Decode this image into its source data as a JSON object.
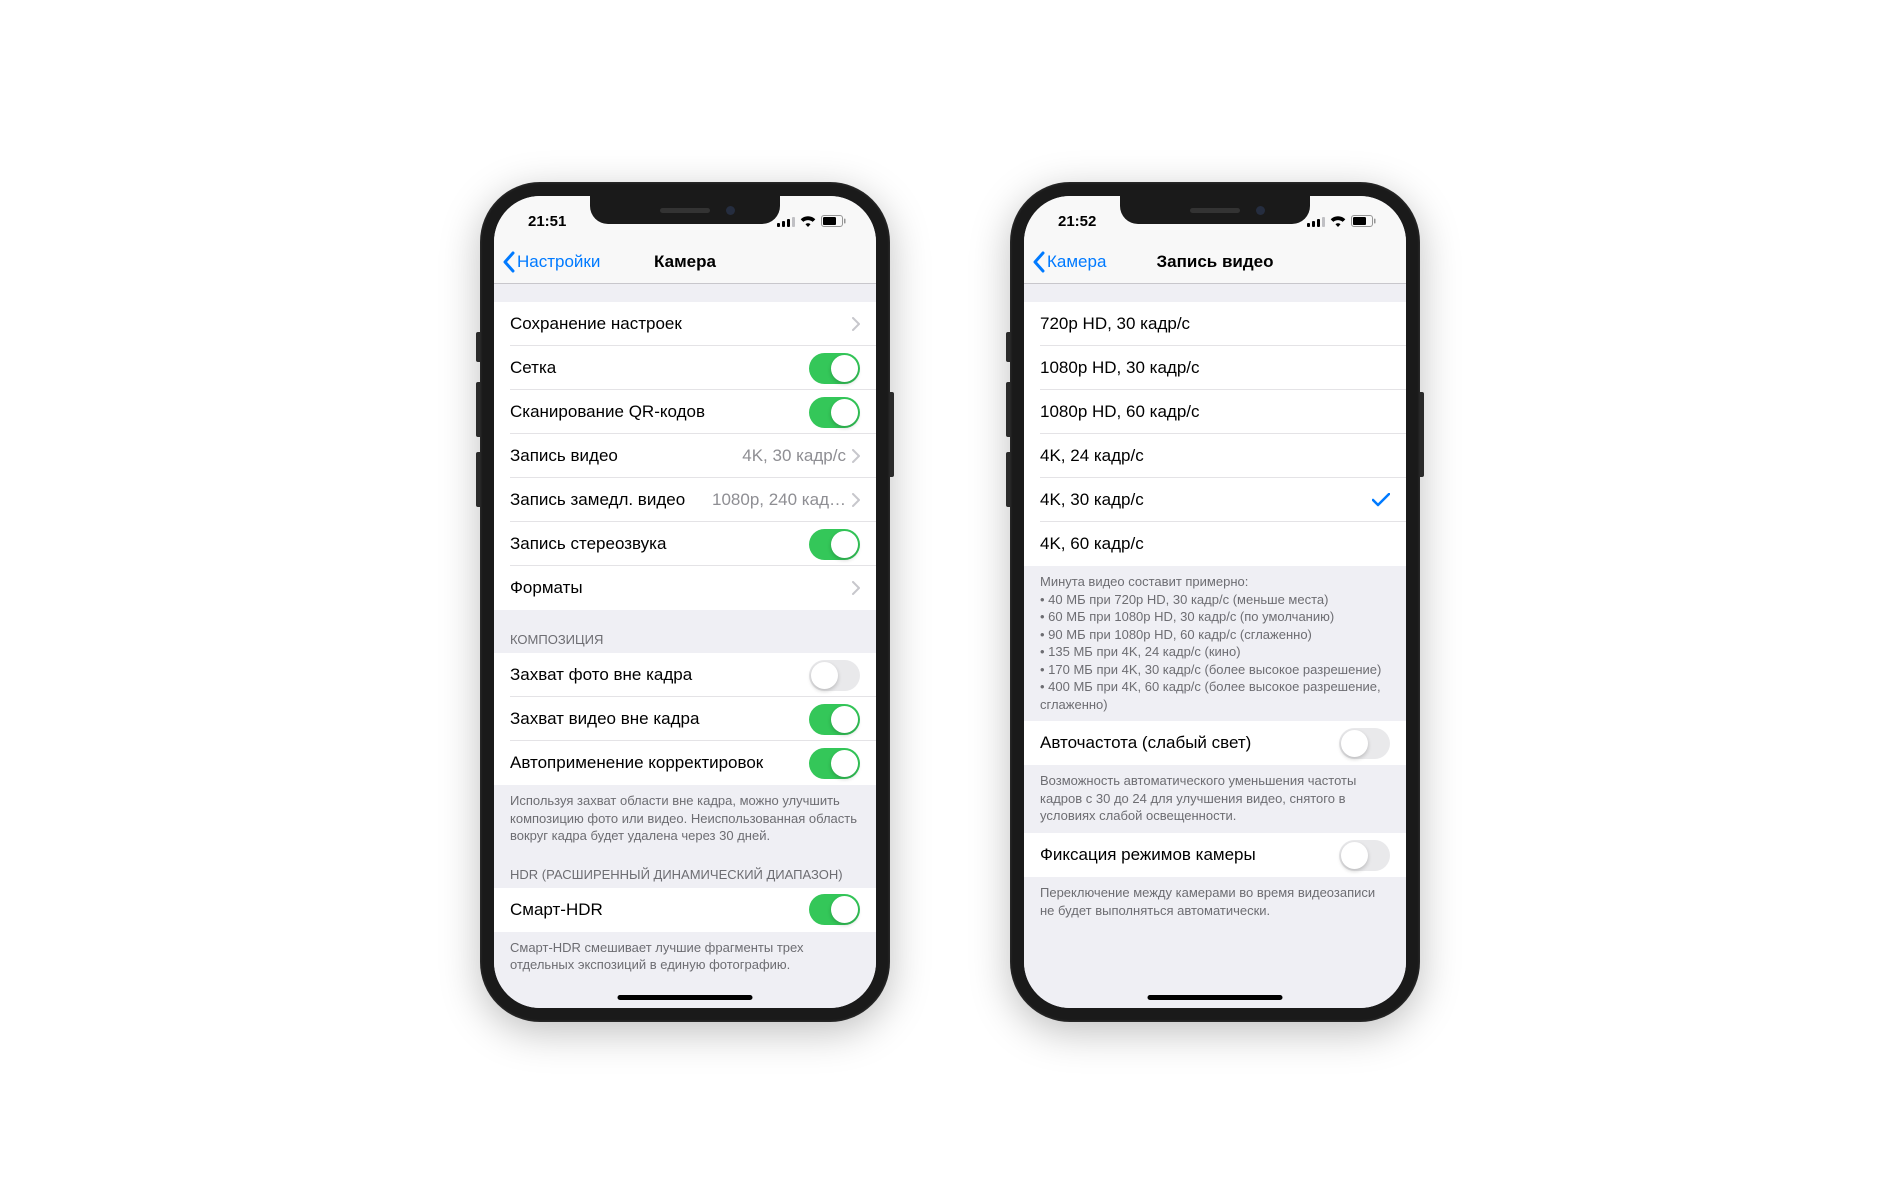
{
  "phone1": {
    "time": "21:51",
    "back": "Настройки",
    "title": "Камера",
    "rows": {
      "preserve": "Сохранение настроек",
      "grid": "Сетка",
      "qr": "Сканирование QR-кодов",
      "video": "Запись видео",
      "video_val": "4K, 30 кадр/с",
      "slomo": "Запись замедл. видео",
      "slomo_val": "1080p, 240 кад…",
      "stereo": "Запись стереозвука",
      "formats": "Форматы"
    },
    "section2_header": "КОМПОЗИЦИЯ",
    "section2_rows": {
      "photo_out": "Захват фото вне кадра",
      "video_out": "Захват видео вне кадра",
      "autocorrect": "Автоприменение корректировок"
    },
    "section2_footer": "Используя захват области вне кадра, можно улучшить композицию фото или видео. Неиспользованная область вокруг кадра будет удалена через 30 дней.",
    "section3_header": "HDR (РАСШИРЕННЫЙ ДИНАМИЧЕСКИЙ ДИАПАЗОН)",
    "section3_rows": {
      "smarthdr": "Смарт-HDR"
    },
    "section3_footer": "Смарт-HDR смешивает лучшие фрагменты трех отдельных экспозиций в единую фотографию."
  },
  "phone2": {
    "time": "21:52",
    "back": "Камера",
    "title": "Запись видео",
    "options": [
      "720p HD, 30 кадр/с",
      "1080p HD, 30 кадр/с",
      "1080p HD, 60 кадр/с",
      "4K, 24 кадр/с",
      "4K, 30 кадр/с",
      "4K, 60 кадр/с"
    ],
    "selected_index": 4,
    "footer_intro": "Минута видео составит примерно:",
    "footer_items": [
      "40 МБ при 720p HD, 30 кадр/с (меньше места)",
      "60 МБ при 1080p HD, 30 кадр/с (по умолчанию)",
      "90 МБ при 1080p HD, 60 кадр/с (сглаженно)",
      "135 МБ при 4K, 24 кадр/с (кино)",
      "170 МБ при 4K, 30 кадр/с (более высокое разрешение)",
      "400 МБ при 4K, 60 кадр/с (более высокое разрешение, сглаженно)"
    ],
    "autofps": "Авточастота (слабый свет)",
    "autofps_footer": "Возможность автоматического уменьшения частоты кадров с 30 до 24 для улучшения видео, снятого в условиях слабой освещенности.",
    "lock": "Фиксация режимов камеры",
    "lock_footer": "Переключение между камерами во время видеозаписи не будет выполняться автоматически."
  }
}
